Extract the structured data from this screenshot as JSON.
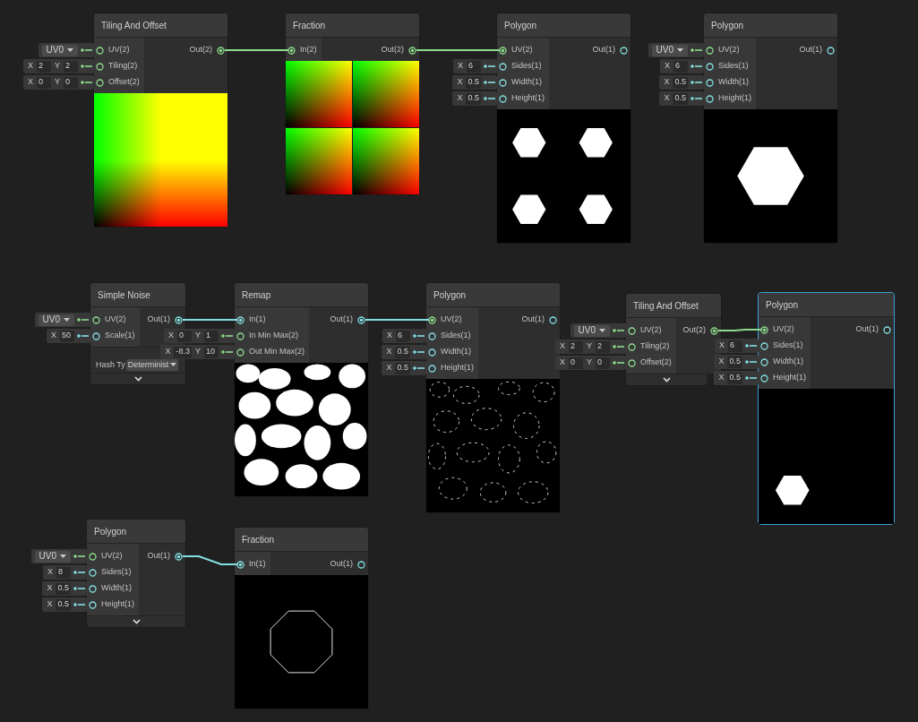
{
  "nodes": [
    {
      "title": "Tiling And Offset",
      "selected": false,
      "inputs": [
        {
          "label": "UV(2)",
          "kind": "vector2",
          "connected": false,
          "field": {
            "kind": "dropdown",
            "value": "UV0"
          }
        },
        {
          "label": "Tiling(2)",
          "kind": "vector2",
          "connected": false,
          "field": {
            "kind": "vector",
            "components": [
              {
                "axis": "X",
                "value": "2"
              },
              {
                "axis": "Y",
                "value": "2"
              }
            ]
          }
        },
        {
          "label": "Offset(2)",
          "kind": "vector2",
          "connected": false,
          "field": {
            "kind": "vector",
            "components": [
              {
                "axis": "X",
                "value": "0"
              },
              {
                "axis": "Y",
                "value": "0"
              }
            ]
          }
        }
      ],
      "outputs": [
        {
          "label": "Out(2)",
          "kind": "vector2",
          "connected": true
        }
      ],
      "preview": {
        "kind": "uv-gradient"
      }
    },
    {
      "title": "Fraction",
      "selected": false,
      "inputs": [
        {
          "label": "In(2)",
          "kind": "vector2",
          "connected": true
        }
      ],
      "outputs": [
        {
          "label": "Out(2)",
          "kind": "vector2",
          "connected": true
        }
      ],
      "preview": {
        "kind": "tiled-gradient"
      }
    },
    {
      "title": "Polygon",
      "selected": false,
      "inputs": [
        {
          "label": "UV(2)",
          "kind": "vector2",
          "connected": true
        },
        {
          "label": "Sides(1)",
          "kind": "vector1",
          "connected": false,
          "field": {
            "kind": "vector",
            "components": [
              {
                "axis": "X",
                "value": "6"
              }
            ]
          }
        },
        {
          "label": "Width(1)",
          "kind": "vector1",
          "connected": false,
          "field": {
            "kind": "vector",
            "components": [
              {
                "axis": "X",
                "value": "0.5"
              }
            ]
          }
        },
        {
          "label": "Height(1)",
          "kind": "vector1",
          "connected": false,
          "field": {
            "kind": "vector",
            "components": [
              {
                "axis": "X",
                "value": "0.5"
              }
            ]
          }
        }
      ],
      "outputs": [
        {
          "label": "Out(1)",
          "kind": "vector1",
          "connected": false
        }
      ],
      "preview": {
        "kind": "hexagon-grid"
      }
    },
    {
      "title": "Polygon",
      "selected": false,
      "inputs": [
        {
          "label": "UV(2)",
          "kind": "vector2",
          "connected": false,
          "field": {
            "kind": "dropdown",
            "value": "UV0"
          }
        },
        {
          "label": "Sides(1)",
          "kind": "vector1",
          "connected": false,
          "field": {
            "kind": "vector",
            "components": [
              {
                "axis": "X",
                "value": "6"
              }
            ]
          }
        },
        {
          "label": "Width(1)",
          "kind": "vector1",
          "connected": false,
          "field": {
            "kind": "vector",
            "components": [
              {
                "axis": "X",
                "value": "0.5"
              }
            ]
          }
        },
        {
          "label": "Height(1)",
          "kind": "vector1",
          "connected": false,
          "field": {
            "kind": "vector",
            "components": [
              {
                "axis": "X",
                "value": "0.5"
              }
            ]
          }
        }
      ],
      "outputs": [
        {
          "label": "Out(1)",
          "kind": "vector1",
          "connected": false
        }
      ],
      "preview": {
        "kind": "hexagon"
      }
    },
    {
      "title": "Simple Noise",
      "selected": false,
      "inputs": [
        {
          "label": "UV(2)",
          "kind": "vector2",
          "connected": false,
          "field": {
            "kind": "dropdown",
            "value": "UV0"
          }
        },
        {
          "label": "Scale(1)",
          "kind": "vector1",
          "connected": false,
          "field": {
            "kind": "vector",
            "components": [
              {
                "axis": "X",
                "value": "50"
              }
            ]
          }
        }
      ],
      "outputs": [
        {
          "label": "Out(1)",
          "kind": "vector1",
          "connected": true
        }
      ],
      "settings": [
        {
          "label": "Hash Ty",
          "value": "Determinist"
        }
      ],
      "footer_toggle": true
    },
    {
      "title": "Remap",
      "selected": false,
      "inputs": [
        {
          "label": "In(1)",
          "kind": "vector1",
          "connected": true
        },
        {
          "label": "In Min Max(2)",
          "kind": "vector2",
          "connected": false,
          "field": {
            "kind": "vector",
            "components": [
              {
                "axis": "X",
                "value": "0"
              },
              {
                "axis": "Y",
                "value": "1"
              }
            ]
          }
        },
        {
          "label": "Out Min Max(2)",
          "kind": "vector2",
          "connected": false,
          "field": {
            "kind": "vector",
            "components": [
              {
                "axis": "X",
                "value": "-8.3"
              },
              {
                "axis": "Y",
                "value": "10"
              }
            ]
          }
        }
      ],
      "outputs": [
        {
          "label": "Out(1)",
          "kind": "vector1",
          "connected": true
        }
      ],
      "preview": {
        "kind": "noise"
      }
    },
    {
      "title": "Polygon",
      "selected": false,
      "inputs": [
        {
          "label": "UV(2)",
          "kind": "vector2",
          "connected": true
        },
        {
          "label": "Sides(1)",
          "kind": "vector1",
          "connected": false,
          "field": {
            "kind": "vector",
            "components": [
              {
                "axis": "X",
                "value": "6"
              }
            ]
          }
        },
        {
          "label": "Width(1)",
          "kind": "vector1",
          "connected": false,
          "field": {
            "kind": "vector",
            "components": [
              {
                "axis": "X",
                "value": "0.5"
              }
            ]
          }
        },
        {
          "label": "Height(1)",
          "kind": "vector1",
          "connected": false,
          "field": {
            "kind": "vector",
            "components": [
              {
                "axis": "X",
                "value": "0.5"
              }
            ]
          }
        }
      ],
      "outputs": [
        {
          "label": "Out(1)",
          "kind": "vector1",
          "connected": false
        }
      ],
      "preview": {
        "kind": "noise-outline"
      }
    },
    {
      "title": "Tiling And Offset",
      "selected": false,
      "inputs": [
        {
          "label": "UV(2)",
          "kind": "vector2",
          "connected": false,
          "field": {
            "kind": "dropdown",
            "value": "UV0"
          }
        },
        {
          "label": "Tiling(2)",
          "kind": "vector2",
          "connected": false,
          "field": {
            "kind": "vector",
            "components": [
              {
                "axis": "X",
                "value": "2"
              },
              {
                "axis": "Y",
                "value": "2"
              }
            ]
          }
        },
        {
          "label": "Offset(2)",
          "kind": "vector2",
          "connected": false,
          "field": {
            "kind": "vector",
            "components": [
              {
                "axis": "X",
                "value": "0"
              },
              {
                "axis": "Y",
                "value": "0"
              }
            ]
          }
        }
      ],
      "outputs": [
        {
          "label": "Out(2)",
          "kind": "vector2",
          "connected": true
        }
      ],
      "footer_toggle": true
    },
    {
      "title": "Polygon",
      "selected": true,
      "inputs": [
        {
          "label": "UV(2)",
          "kind": "vector2",
          "connected": true
        },
        {
          "label": "Sides(1)",
          "kind": "vector1",
          "connected": false,
          "field": {
            "kind": "vector",
            "components": [
              {
                "axis": "X",
                "value": "6"
              }
            ]
          }
        },
        {
          "label": "Width(1)",
          "kind": "vector1",
          "connected": false,
          "field": {
            "kind": "vector",
            "components": [
              {
                "axis": "X",
                "value": "0.5"
              }
            ]
          }
        },
        {
          "label": "Height(1)",
          "kind": "vector1",
          "connected": false,
          "field": {
            "kind": "vector",
            "components": [
              {
                "axis": "X",
                "value": "0.5"
              }
            ]
          }
        }
      ],
      "outputs": [
        {
          "label": "Out(1)",
          "kind": "vector1",
          "connected": false
        }
      ],
      "preview": {
        "kind": "hexagon-small"
      }
    },
    {
      "title": "Polygon",
      "selected": false,
      "inputs": [
        {
          "label": "UV(2)",
          "kind": "vector2",
          "connected": false,
          "field": {
            "kind": "dropdown",
            "value": "UV0"
          }
        },
        {
          "label": "Sides(1)",
          "kind": "vector1",
          "connected": false,
          "field": {
            "kind": "vector",
            "components": [
              {
                "axis": "X",
                "value": "8"
              }
            ]
          }
        },
        {
          "label": "Width(1)",
          "kind": "vector1",
          "connected": false,
          "field": {
            "kind": "vector",
            "components": [
              {
                "axis": "X",
                "value": "0.5"
              }
            ]
          }
        },
        {
          "label": "Height(1)",
          "kind": "vector1",
          "connected": false,
          "field": {
            "kind": "vector",
            "components": [
              {
                "axis": "X",
                "value": "0.5"
              }
            ]
          }
        }
      ],
      "outputs": [
        {
          "label": "Out(1)",
          "kind": "vector1",
          "connected": true
        }
      ],
      "footer_toggle": true
    },
    {
      "title": "Fraction",
      "selected": false,
      "inputs": [
        {
          "label": "In(1)",
          "kind": "vector1",
          "connected": true
        }
      ],
      "outputs": [
        {
          "label": "Out(1)",
          "kind": "vector1",
          "connected": false
        }
      ],
      "preview": {
        "kind": "octagon-outline"
      }
    }
  ]
}
